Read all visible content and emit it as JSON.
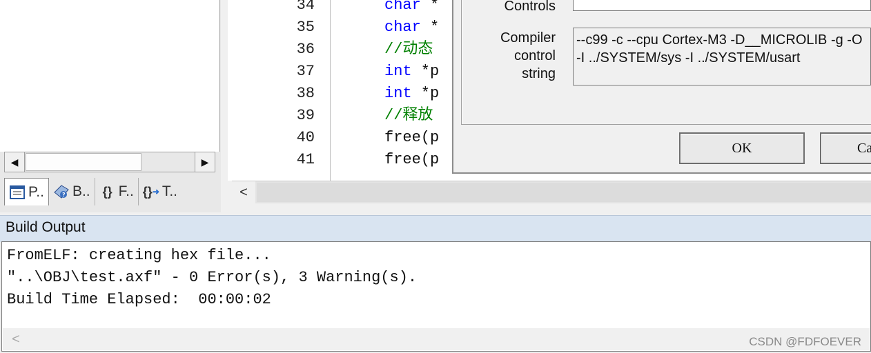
{
  "project_panel": {
    "tabs": [
      {
        "label": "P..",
        "icon": "project-icon"
      },
      {
        "label": "B..",
        "icon": "books-icon"
      },
      {
        "label": "F..",
        "icon": "functions-icon"
      },
      {
        "label": "T..",
        "icon": "templates-icon"
      }
    ]
  },
  "editor": {
    "lines": [
      {
        "num": "34",
        "kw": "char",
        "rest": " *"
      },
      {
        "num": "35",
        "kw": "char",
        "rest": " *"
      },
      {
        "num": "36",
        "comment": "//动态"
      },
      {
        "num": "37",
        "kw": "int",
        "rest": " *p"
      },
      {
        "num": "38",
        "kw": "int",
        "rest": " *p"
      },
      {
        "num": "39",
        "comment": "//释放"
      },
      {
        "num": "40",
        "text": "free(p"
      },
      {
        "num": "41",
        "text": "free(p"
      }
    ]
  },
  "dialog": {
    "controls_label": "Controls",
    "compiler_label_1": "Compiler",
    "compiler_label_2": "control",
    "compiler_label_3": "string",
    "compiler_string_line1": "--c99 -c --cpu Cortex-M3 -D__MICROLIB -g -O",
    "compiler_string_line2": "-I ../SYSTEM/sys -I ../SYSTEM/usart",
    "ok_label": "OK",
    "cancel_label": "Ca"
  },
  "build_output": {
    "title": "Build Output",
    "lines": [
      "FromELF: creating hex file...",
      "\"..\\OBJ\\test.axf\" - 0 Error(s), 3 Warning(s).",
      "Build Time Elapsed:  00:00:02"
    ]
  },
  "watermark": "CSDN @FDFOEVER"
}
